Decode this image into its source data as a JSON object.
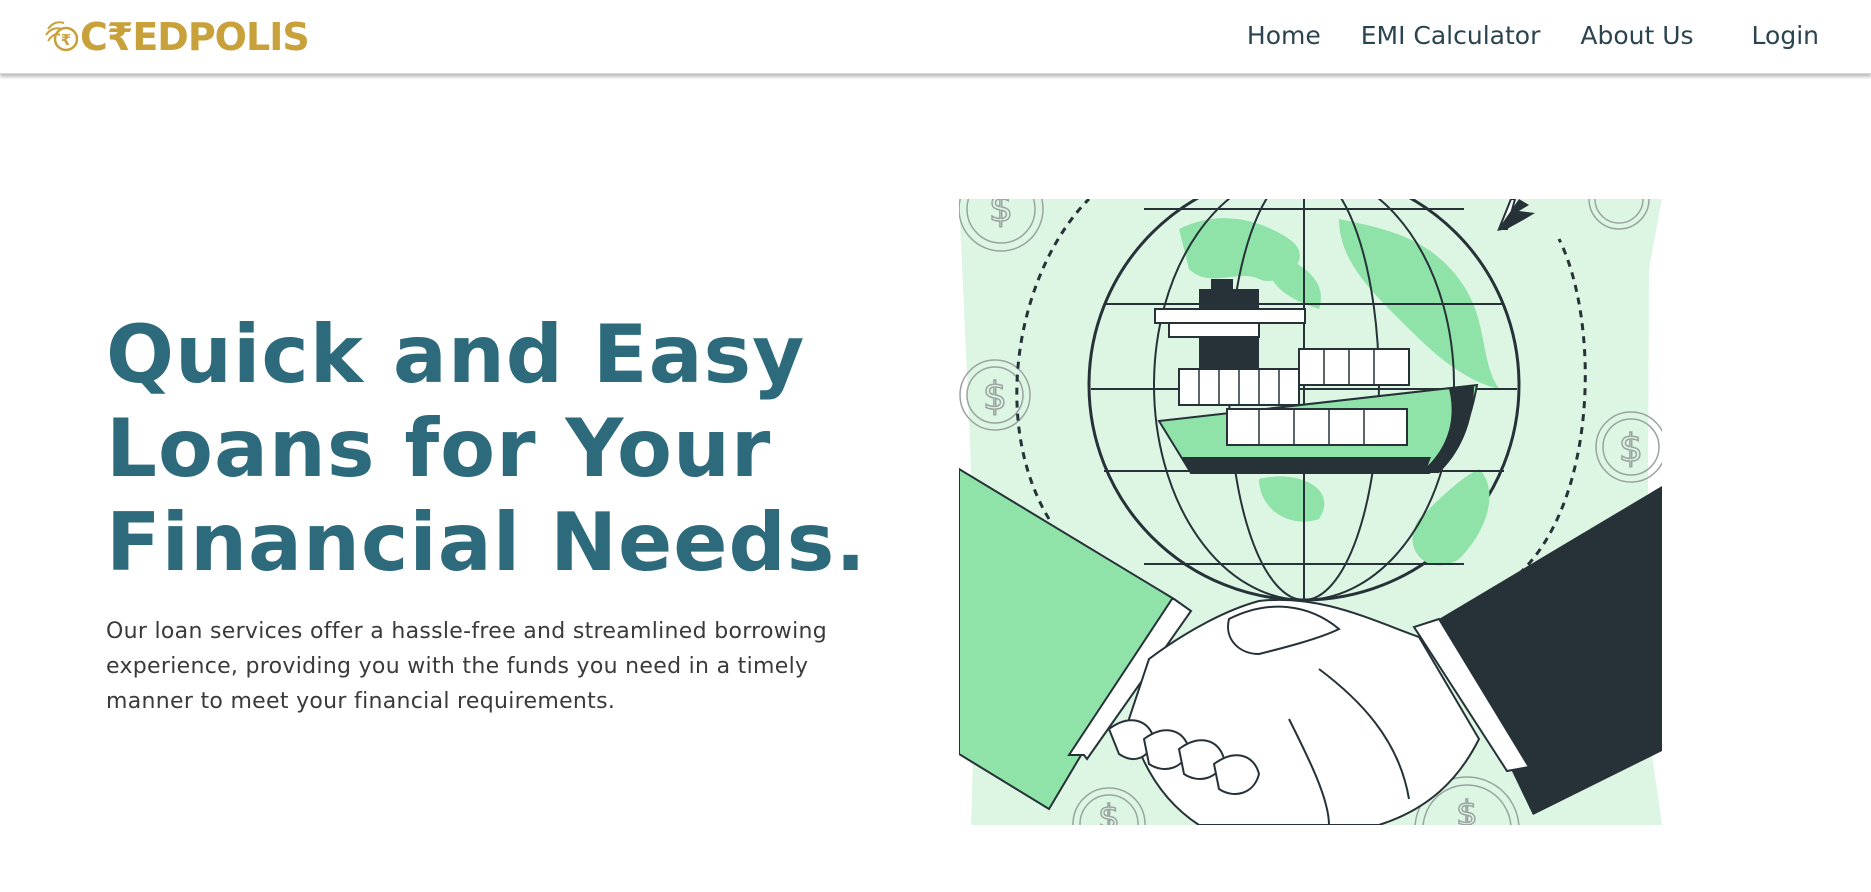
{
  "brand": {
    "name": "CREDPOLIS",
    "logo_text": "C₹EDPOLIS",
    "color": "#c9a13b"
  },
  "nav": {
    "home": "Home",
    "emi_calculator": "EMI Calculator",
    "about_us": "About Us",
    "login": "Login"
  },
  "hero": {
    "title": "Quick and Easy Loans for Your Financial Needs.",
    "description": "Our loan services offer a hassle-free and streamlined borrowing experience, providing you with the funds you need in a timely manner to meet your financial requirements."
  },
  "illustration": {
    "subject": "handshake-globe-cargo-ship-illustration"
  },
  "colors": {
    "heading": "#2c6a7c",
    "nav_text": "#2b4450",
    "body_text": "#3a3a3a",
    "illustration_light": "#ddf6e4",
    "illustration_green": "#8fe2a8",
    "illustration_dark": "#263238"
  }
}
